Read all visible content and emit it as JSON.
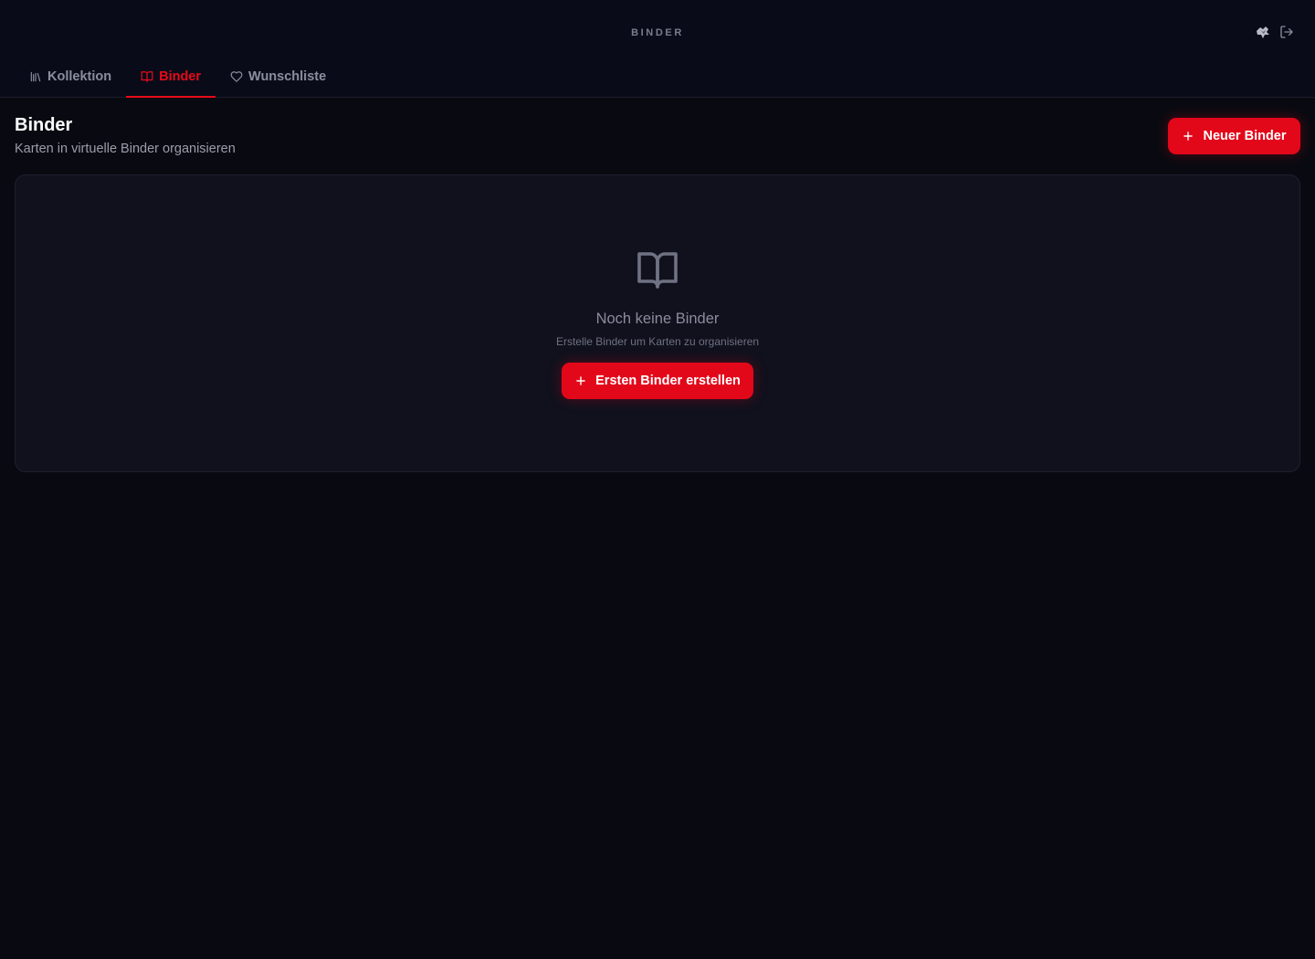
{
  "header": {
    "app_title": "BINDER"
  },
  "tabs": [
    {
      "label": "Kollektion",
      "icon": "library-icon",
      "active": false
    },
    {
      "label": "Binder",
      "icon": "book-open-icon",
      "active": true
    },
    {
      "label": "Wunschliste",
      "icon": "heart-icon",
      "active": false
    }
  ],
  "page": {
    "title": "Binder",
    "subtitle": "Karten in virtuelle Binder organisieren",
    "new_button_label": "Neuer Binder"
  },
  "empty_state": {
    "icon": "book-open-icon",
    "title": "Noch keine Binder",
    "subtitle": "Erstelle Binder um Karten zu organisieren",
    "button_label": "Ersten Binder erstellen"
  },
  "colors": {
    "accent": "#e3071a",
    "background": "#090a11",
    "card": "#10111d",
    "muted_text": "#8b8e9e"
  }
}
